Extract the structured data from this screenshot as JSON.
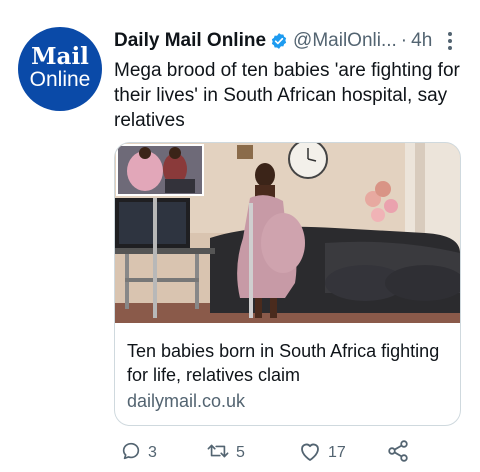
{
  "tweet": {
    "author": {
      "avatar_line1": "Mail",
      "avatar_line2": "Online",
      "name": "Daily Mail Online",
      "handle": "@MailOnli...",
      "separator": "·",
      "time": "4h"
    },
    "text": "Mega brood of ten babies 'are fighting for their lives' in South African hospital, say relatives",
    "card": {
      "title": "Ten babies born in South Africa fighting for life, relatives claim",
      "domain": "dailymail.co.uk"
    },
    "actions": {
      "replies": "3",
      "retweets": "5",
      "likes": "17"
    }
  },
  "colors": {
    "avatar_bg": "#0a4aa8",
    "verified": "#1d9bf0",
    "secondary_text": "#536471",
    "border": "#cfd9de"
  },
  "icons": [
    "verified-badge-icon",
    "more-options-icon",
    "reply-icon",
    "retweet-icon",
    "like-icon",
    "share-icon"
  ]
}
